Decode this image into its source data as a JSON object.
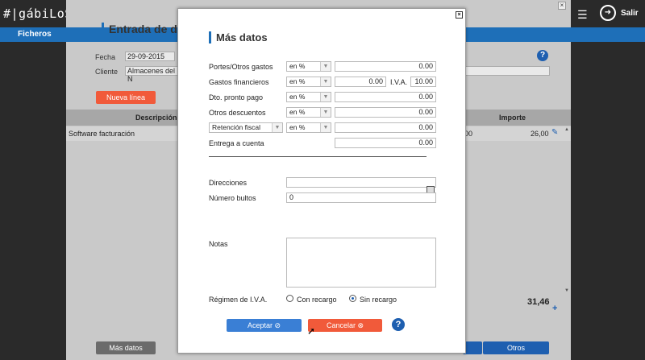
{
  "app": {
    "logo": "#|gábiLoS",
    "exit_label": "Salir"
  },
  "menu": {
    "ficheros": "Ficheros"
  },
  "background": {
    "title": "Entrada de dato",
    "fecha_label": "Fecha",
    "fecha_value": "29-09-2015",
    "cliente_label": "Cliente",
    "cliente_value": "Almacenes del N",
    "nueva_linea": "Nueva línea",
    "col_descripcion": "Descripción a",
    "col_importe": "Importe",
    "row_desc": "Software facturación",
    "row_partial": "00",
    "row_importe": "26,00",
    "total": "31,46",
    "mas_datos_btn": "Más datos",
    "otros_btn": "Otros",
    "help": "?"
  },
  "modal": {
    "title": "Más datos",
    "rows": [
      {
        "label": "Portes/Otros gastos",
        "unit": "en %",
        "value": "0.00"
      },
      {
        "label": "Gastos financieros",
        "unit": "en %",
        "value": "0.00",
        "iva_label": "I.V.A.",
        "iva_value": "10.00"
      },
      {
        "label": "Dto. pronto pago",
        "unit": "en %",
        "value": "0.00"
      },
      {
        "label": "Otros descuentos",
        "unit": "en %",
        "value": "0.00"
      },
      {
        "label": "Retención fiscal",
        "unit": "en %",
        "value": "0.00"
      },
      {
        "label": "Entrega a cuenta",
        "value": "0.00"
      }
    ],
    "direcciones_label": "Direcciones",
    "direcciones_value": "",
    "bultos_label": "Número bultos",
    "bultos_value": "0",
    "notas_label": "Notas",
    "regimen_label": "Régimen de I.V.A.",
    "con_recargo": "Con recargo",
    "sin_recargo": "Sin recargo",
    "selected_regimen": "Sin recargo",
    "aceptar": "Aceptar",
    "cancelar": "Cancelar",
    "help": "?"
  },
  "colors": {
    "accent_blue": "#1e6fb8",
    "cancel_red": "#f15a3a",
    "dark_bg": "#2a2a2a"
  }
}
